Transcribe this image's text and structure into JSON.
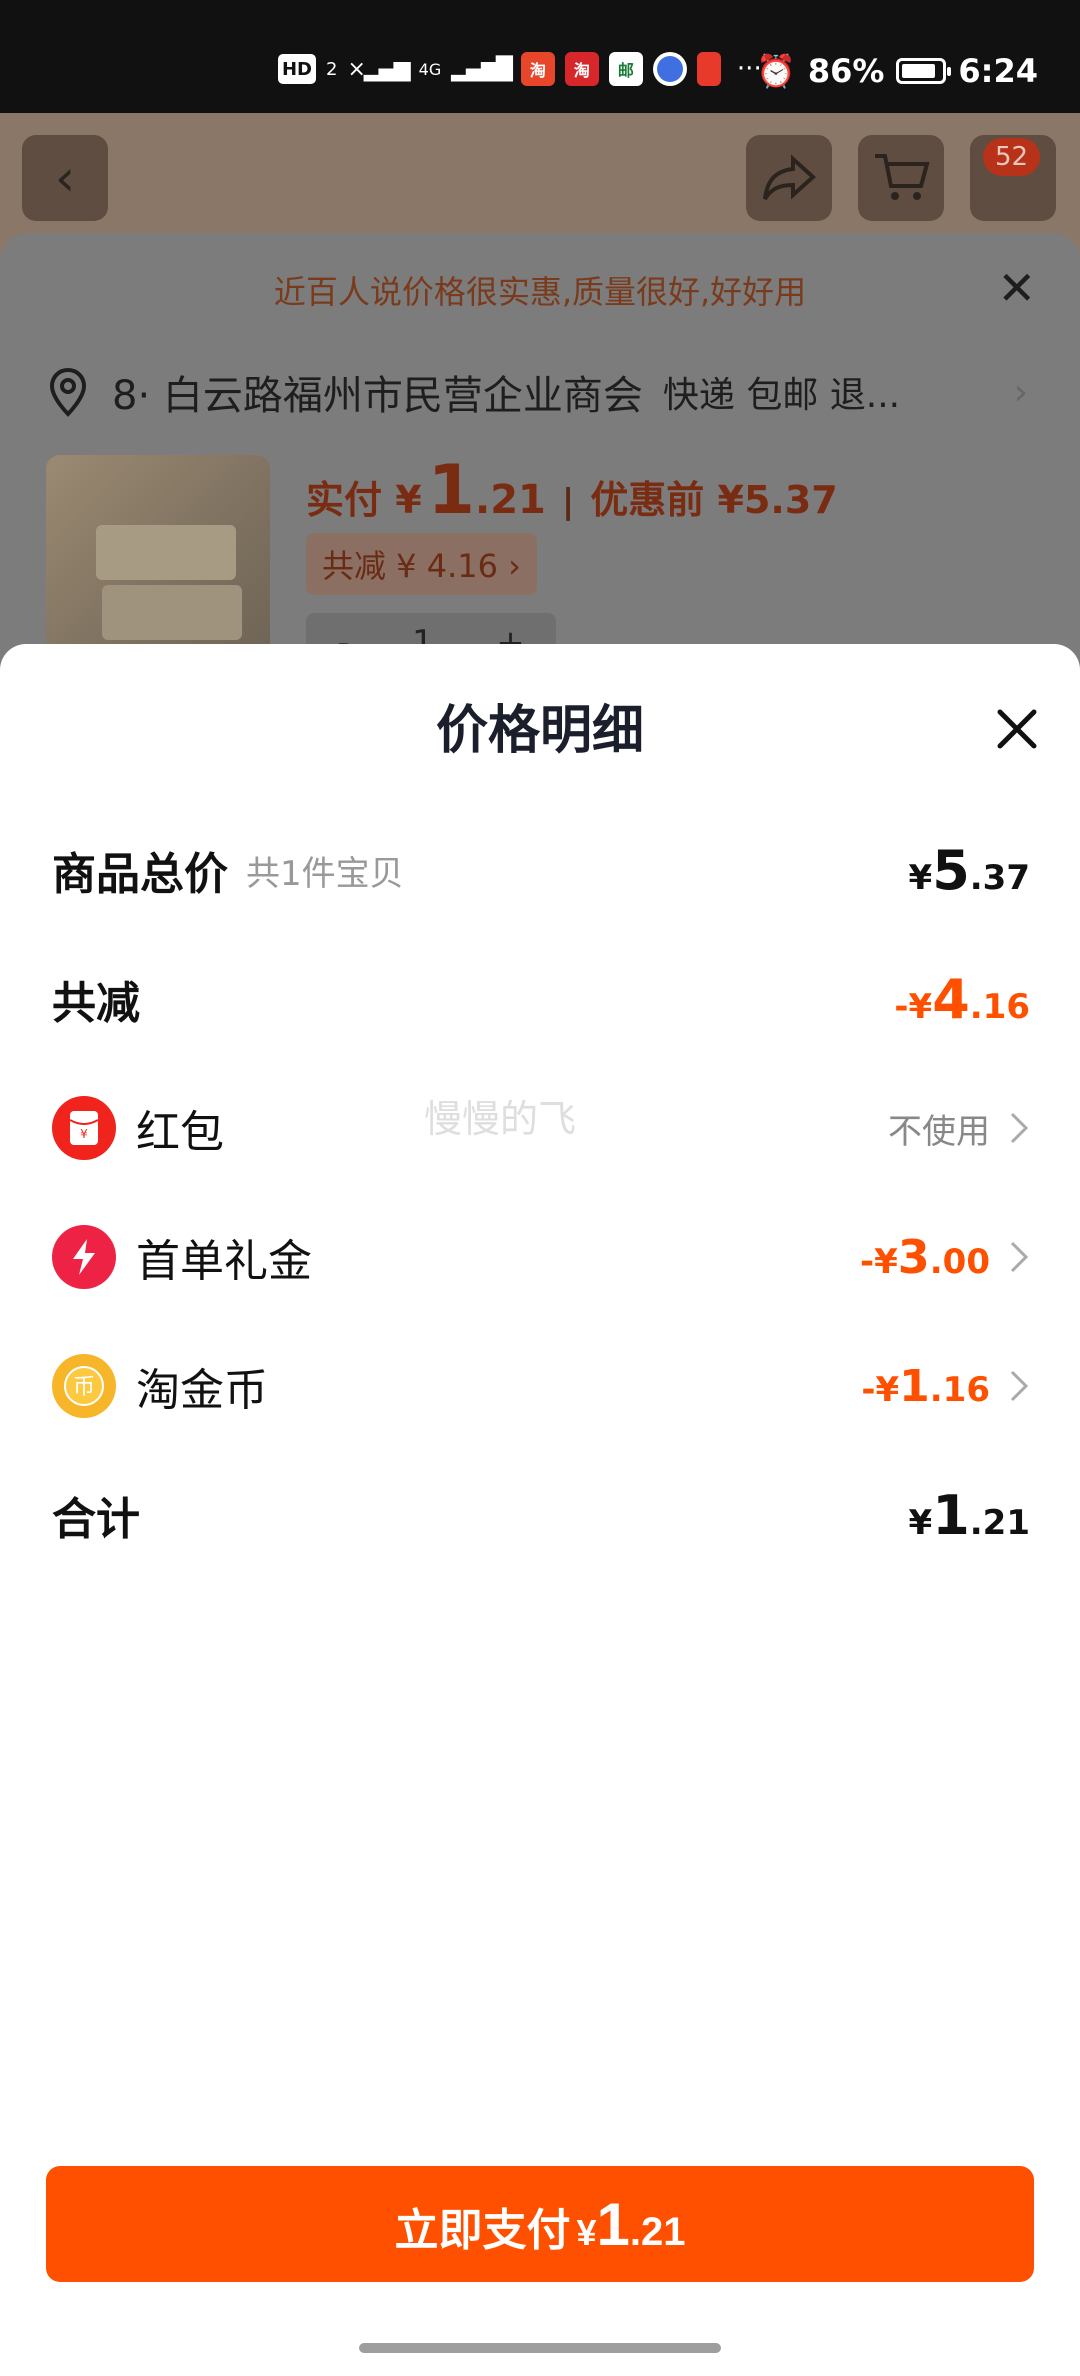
{
  "status_bar": {
    "hd": "HD",
    "sim": "2",
    "network": "4G",
    "battery_text": "86%",
    "battery_level": 0.86,
    "time": "6:24",
    "more": "···"
  },
  "background_page": {
    "cart_badge": "52",
    "tip": "近百人说价格很实惠,质量很好,好好用",
    "address": "8· 白云路福州市民营企业商会",
    "address_tail": "快递 包邮 退...",
    "pay_label": "实付 ¥",
    "pay_int": "1",
    "pay_dec": ".21",
    "sep": "|",
    "orig_price": "优惠前 ¥5.37",
    "reduce_tag": "共减 ¥ 4.16 ›",
    "qty_minus": "-",
    "qty_value": "1",
    "qty_plus": "+"
  },
  "detail": {
    "title": "价格明细",
    "watermark": "慢慢的飞",
    "total": {
      "label": "商品总价",
      "sub": "共1件宝贝",
      "cur": "¥",
      "int": "5",
      "dec": ".37"
    },
    "reduce": {
      "label": "共减",
      "cur": "-¥",
      "int": "4",
      "dec": ".16"
    },
    "red_packet": {
      "label": "红包",
      "value": "不使用"
    },
    "first_order": {
      "label": "首单礼金",
      "cur": "-¥",
      "int": "3",
      "dec": ".00"
    },
    "coins": {
      "label": "淘金币",
      "cur": "-¥",
      "int": "1",
      "dec": ".16"
    },
    "sum": {
      "label": "合计",
      "cur": "¥",
      "int": "1",
      "dec": ".21"
    }
  },
  "pay_button": {
    "label": "立即支付",
    "cur": "¥",
    "int": "1",
    "dec": ".21"
  },
  "colors": {
    "accent": "#ff5000",
    "title": "#1a1f2b"
  }
}
